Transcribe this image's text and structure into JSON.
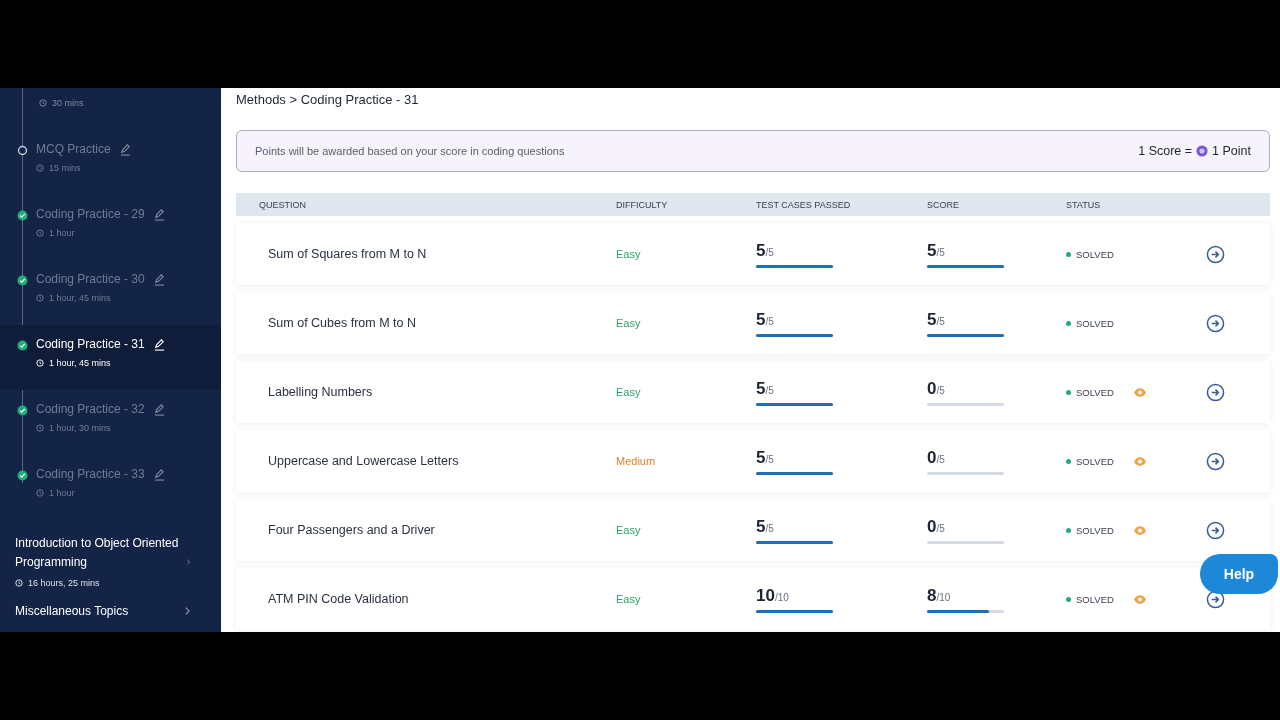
{
  "sidebar": {
    "first_duration": "30 mins",
    "items": [
      {
        "title": "MCQ Practice",
        "duration": "15 mins",
        "kind": "pending",
        "selected": false
      },
      {
        "title": "Coding Practice - 29",
        "duration": "1 hour",
        "kind": "done",
        "selected": false
      },
      {
        "title": "Coding Practice - 30",
        "duration": "1 hour, 45 mins",
        "kind": "done",
        "selected": false
      },
      {
        "title": "Coding Practice - 31",
        "duration": "1 hour, 45 mins",
        "kind": "done",
        "selected": true
      },
      {
        "title": "Coding Practice - 32",
        "duration": "1 hour, 30 mins",
        "kind": "done",
        "selected": false
      },
      {
        "title": "Coding Practice - 33",
        "duration": "1 hour",
        "kind": "done",
        "selected": false
      }
    ],
    "sections": [
      {
        "title": "Introduction to Object Oriented Programming",
        "duration": "16 hours, 25 mins"
      },
      {
        "title": "Miscellaneous Topics"
      }
    ]
  },
  "breadcrumb": "Methods > Coding Practice - 31",
  "info": {
    "text": "Points will be awarded based on your score in coding questions",
    "score_left": "1 Score =",
    "score_right": "1 Point"
  },
  "table": {
    "columns": [
      "QUESTION",
      "DIFFICULTY",
      "TEST CASES PASSED",
      "SCORE",
      "STATUS"
    ],
    "rows": [
      {
        "question": "Sum of Squares from M to N",
        "difficulty": "Easy",
        "kind": "easy",
        "passed": {
          "value": "5",
          "total": "/5",
          "level": 1
        },
        "score": {
          "value": "5",
          "total": "/5",
          "level": 1
        },
        "status": "SOLVED",
        "eye": false
      },
      {
        "question": "Sum of Cubes from M to N",
        "difficulty": "Easy",
        "kind": "easy",
        "passed": {
          "value": "5",
          "total": "/5",
          "level": 1
        },
        "score": {
          "value": "5",
          "total": "/5",
          "level": 1
        },
        "status": "SOLVED",
        "eye": false
      },
      {
        "question": "Labelling Numbers",
        "difficulty": "Easy",
        "kind": "easy",
        "passed": {
          "value": "5",
          "total": "/5",
          "level": 1
        },
        "score": {
          "value": "0",
          "total": "/5",
          "level": 0
        },
        "status": "SOLVED",
        "eye": true
      },
      {
        "question": "Uppercase and Lowercase Letters",
        "difficulty": "Medium",
        "kind": "medium",
        "passed": {
          "value": "5",
          "total": "/5",
          "level": 1
        },
        "score": {
          "value": "0",
          "total": "/5",
          "level": 0
        },
        "status": "SOLVED",
        "eye": true
      },
      {
        "question": "Four Passengers and a Driver",
        "difficulty": "Easy",
        "kind": "easy",
        "passed": {
          "value": "5",
          "total": "/5",
          "level": 1
        },
        "score": {
          "value": "0",
          "total": "/5",
          "level": 0
        },
        "status": "SOLVED",
        "eye": true
      },
      {
        "question": "ATM PIN Code Validation",
        "difficulty": "Easy",
        "kind": "easy",
        "passed": {
          "value": "10",
          "total": "/10",
          "level": 1
        },
        "score": {
          "value": "8",
          "total": "/10",
          "level": 0.8
        },
        "status": "SOLVED",
        "eye": true
      }
    ]
  },
  "help": "Help"
}
